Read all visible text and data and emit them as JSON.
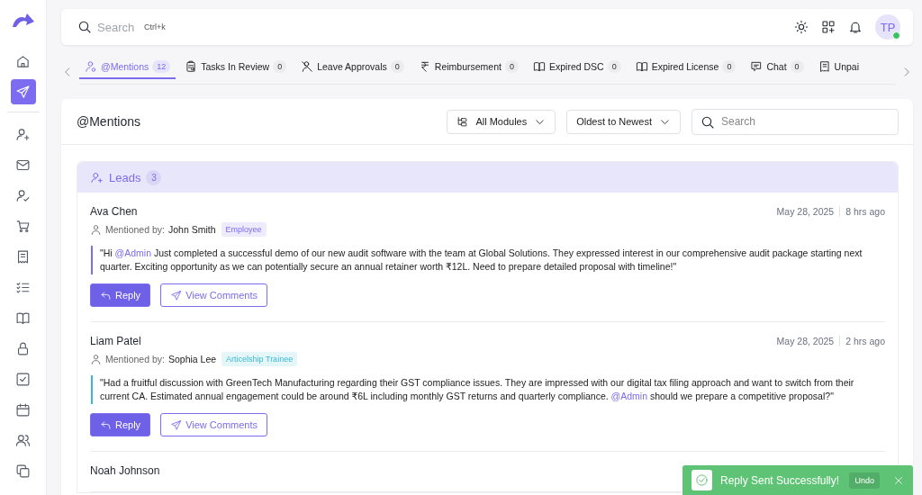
{
  "sidebar": {
    "items": [
      {
        "selected": false
      },
      {
        "selected": true
      },
      {
        "selected": false
      },
      {
        "selected": false
      },
      {
        "selected": false
      },
      {
        "selected": false
      },
      {
        "selected": false
      },
      {
        "selected": false
      },
      {
        "selected": false
      },
      {
        "selected": false
      },
      {
        "selected": false
      },
      {
        "selected": false
      },
      {
        "selected": false
      },
      {
        "selected": false
      }
    ]
  },
  "topbar": {
    "search": {
      "placeholder": "Search",
      "shortcut": "Ctrl+k"
    },
    "avatar": {
      "initials": "TP",
      "online": true
    }
  },
  "tabs": [
    {
      "label": "@Mentions",
      "count": "12",
      "selected": true
    },
    {
      "label": "Tasks In Review",
      "count": "0",
      "selected": false
    },
    {
      "label": "Leave Approvals",
      "count": "0",
      "selected": false
    },
    {
      "label": "Reimbursement",
      "count": "0",
      "selected": false
    },
    {
      "label": "Expired DSC",
      "count": "0",
      "selected": false
    },
    {
      "label": "Expired License",
      "count": "0",
      "selected": false
    },
    {
      "label": "Chat",
      "count": "0",
      "selected": false
    },
    {
      "label": "Unpai",
      "selected": false
    }
  ],
  "panel": {
    "title": "@Mentions",
    "filters": [
      {
        "label": "All Modules"
      },
      {
        "label": "Oldest to Newest"
      }
    ],
    "search": {
      "placeholder": "Search"
    },
    "group": {
      "title": "Leads",
      "count": "3",
      "items": [
        {
          "name": "Ava Chen",
          "date": "May 28, 2025",
          "ago": "8 hrs ago",
          "mentioned_label": "Mentioned by:",
          "mentioned_by": "John Smith",
          "role": "Employee",
          "color": "#7b6cf0",
          "message": [
            {
              "kind": "text",
              "text": "\"Hi "
            },
            {
              "kind": "mention",
              "text": "@Admin"
            },
            {
              "kind": "text",
              "text": " Just completed a successful demo of our new audit software with the team at Global Solutions. They expressed interest in our comprehensive audit package starting next quarter. Exciting opportunity as we can potentially secure an annual retainer worth ₹12L. Need to prepare detailed proposal with timeline!\""
            }
          ],
          "actions": [
            "Reply",
            "View Comments"
          ]
        },
        {
          "name": "Liam Patel",
          "date": "May 28, 2025",
          "ago": "2 hrs ago",
          "mentioned_label": "Mentioned by:",
          "mentioned_by": "Sophia Lee",
          "role": "Articelship Trainee",
          "color": "#3cb8d4",
          "message": [
            {
              "kind": "text",
              "text": "\"Had a fruitful discussion with GreenTech Manufacturing regarding their GST compliance issues. They are impressed with our digital tax filing approach and want to switch from their current CA. Estimated annual engagement could be around ₹6L including monthly GST returns and quarterly compliance. "
            },
            {
              "kind": "mention",
              "text": "@Admin"
            },
            {
              "kind": "text",
              "text": " should we prepare a competitive proposal?\""
            }
          ],
          "actions": [
            "Reply",
            "View Comments"
          ]
        },
        {
          "name": "Noah Johnson"
        }
      ]
    }
  },
  "toast": {
    "message": "Reply Sent Successfully!",
    "action": "Undo"
  }
}
